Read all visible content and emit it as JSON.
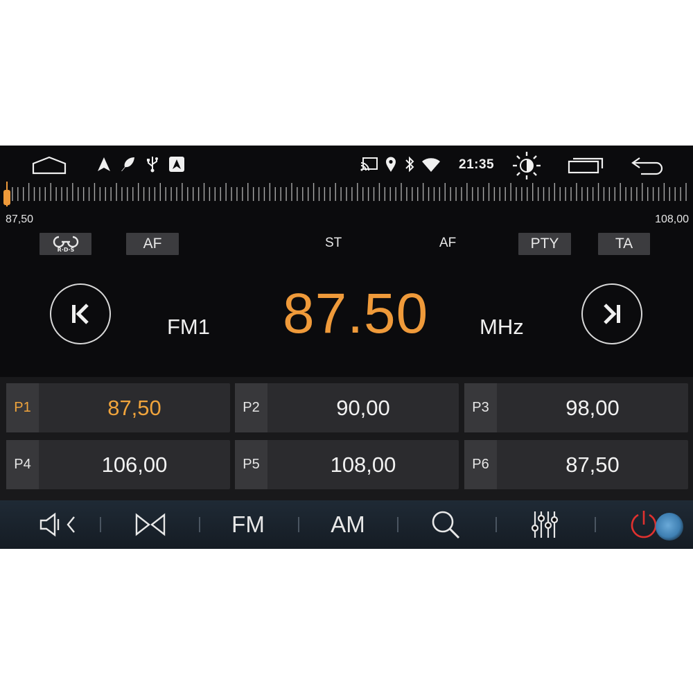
{
  "status_bar": {
    "time": "21:35",
    "icons_left": [
      "home-icon",
      "navigation-arrow-icon",
      "feather-icon",
      "usb-icon",
      "android-auto-icon"
    ],
    "icons_right": [
      "cast-icon",
      "location-icon",
      "bluetooth-icon",
      "wifi-icon",
      "brightness-icon",
      "recent-apps-icon",
      "back-icon"
    ]
  },
  "tuner": {
    "min_label": "87,50",
    "max_label": "108,00",
    "min_mhz": 87.5,
    "max_mhz": 108.0,
    "current_mhz": 87.5
  },
  "rds": {
    "rds_logo": "rds-logo-icon",
    "af_button": "AF",
    "st_indicator": "ST",
    "af_indicator": "AF",
    "pty_button": "PTY",
    "ta_button": "TA"
  },
  "main": {
    "band": "FM1",
    "frequency": "87.50",
    "unit": "MHz",
    "prev_icon": "skip-previous-icon",
    "next_icon": "skip-next-icon"
  },
  "presets": [
    {
      "label": "P1",
      "value": "87,50",
      "active": true
    },
    {
      "label": "P2",
      "value": "90,00",
      "active": false
    },
    {
      "label": "P3",
      "value": "98,00",
      "active": false
    },
    {
      "label": "P4",
      "value": "106,00",
      "active": false
    },
    {
      "label": "P5",
      "value": "108,00",
      "active": false
    },
    {
      "label": "P6",
      "value": "87,50",
      "active": false
    }
  ],
  "toolbar": {
    "fm_label": "FM",
    "am_label": "AM",
    "icons": [
      "speaker-mute-icon",
      "stereo-icon",
      "search-icon",
      "equalizer-icon",
      "power-icon"
    ]
  },
  "colors": {
    "accent": "#ef9a3a",
    "background": "#0b0b0d",
    "power": "#e0312f"
  }
}
